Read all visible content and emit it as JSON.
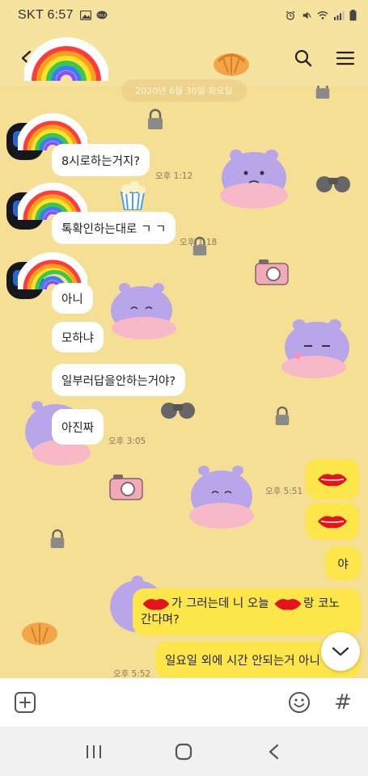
{
  "status_bar": {
    "carrier": "SKT",
    "time": "6:57"
  },
  "date_divider": "2020년 6월 30일 화요일",
  "messages": [
    {
      "sender": "friend",
      "text": "8시로하는거지?",
      "time": "오후 1:12"
    },
    {
      "sender": "friend",
      "text": "톡확인하는대로 ㄱ ㄱ",
      "time": "오후 1:18"
    },
    {
      "sender": "friend",
      "text": "아니",
      "time": ""
    },
    {
      "sender": "friend",
      "text": "모하냐",
      "time": ""
    },
    {
      "sender": "friend",
      "text": "일부러답을안하는거야?",
      "time": ""
    },
    {
      "sender": "friend",
      "text": "아진짜",
      "time": "오후 3:05"
    },
    {
      "sender": "me",
      "text": "",
      "time": "오후 5:51"
    },
    {
      "sender": "me",
      "text": "",
      "time": ""
    },
    {
      "sender": "me",
      "text": "야",
      "time": ""
    },
    {
      "sender": "me",
      "text_a": "가 그러는데 니 오늘 ",
      "text_b": "랑 코노",
      "text_c": "간다며?",
      "time": ""
    },
    {
      "sender": "me",
      "text": "일요일 외에 시간 안되는거 아니",
      "time": "오후 5:52"
    }
  ],
  "colors": {
    "background": "#f5df94",
    "my_bubble": "#fde64a",
    "friend_bubble": "#ffffff"
  },
  "icons": {
    "back": "arrow-left-icon",
    "search": "search-icon",
    "menu": "hamburger-menu-icon",
    "attach": "plus-square-icon",
    "emoji": "smiley-icon",
    "hash": "#",
    "scroll_down": "chevron-down-icon"
  }
}
